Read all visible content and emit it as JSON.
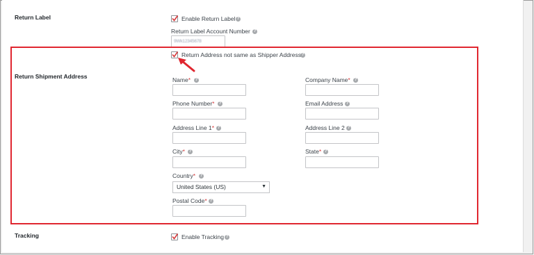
{
  "return_label": {
    "section_title": "Return Label",
    "enable_label": "Enable Return Label",
    "account_number_label": "Return Label Account Number",
    "account_number_value": "9Wk12345678"
  },
  "return_shipment": {
    "section_title": "Return Shipment Address",
    "not_same_label": "Return Address not same as Shipper Address",
    "fields": {
      "name": "Name",
      "company_name": "Company Name",
      "phone_number": "Phone Number",
      "email_address": "Email Address",
      "address_line_1": "Address Line 1",
      "address_line_2": "Address Line 2",
      "city": "City",
      "state": "State",
      "country": "Country",
      "postal_code": "Postal Code"
    },
    "required_mark": "*",
    "country_value": "United States (US)"
  },
  "tracking": {
    "section_title": "Tracking",
    "enable_label": "Enable Tracking"
  },
  "icons": {
    "help": "?",
    "check": "✓",
    "dropdown": "▼"
  },
  "colors": {
    "highlight_border": "#e0262f",
    "arrow": "#e0262f",
    "required": "#d63638",
    "check": "#d63638"
  }
}
